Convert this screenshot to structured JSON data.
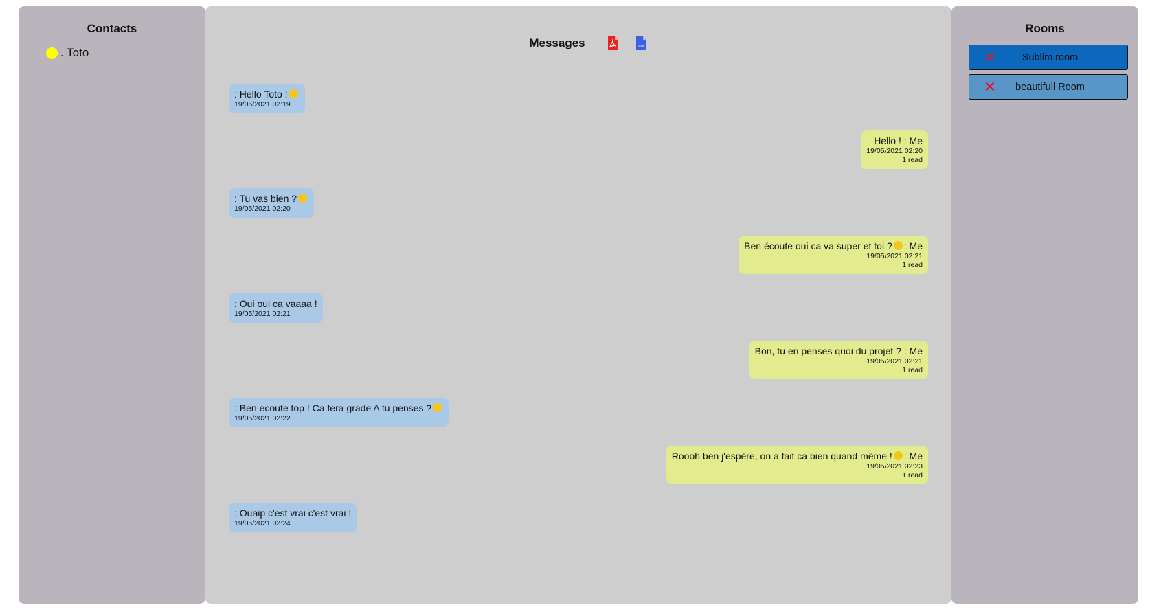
{
  "contacts": {
    "title": "Contacts",
    "items": [
      {
        "label": ". Toto",
        "status_color": "#ffff00"
      }
    ]
  },
  "messages": {
    "title": "Messages",
    "export_pdf_icon": "pdf-file-icon",
    "export_csv_icon": "csv-file-icon",
    "csv_icon_text": "csv",
    "list": [
      {
        "side": "in",
        "text": ": Hello Toto !",
        "emoji": "smiling-face",
        "time": "19/05/2021 02:19",
        "read": ""
      },
      {
        "side": "out",
        "text": "Hello ! : Me",
        "emoji": "",
        "time": "19/05/2021 02:20",
        "read": "1 read"
      },
      {
        "side": "in",
        "text": ": Tu vas bien ?",
        "emoji": "smiling-face-with-hearts",
        "time": "19/05/2021 02:20",
        "read": ""
      },
      {
        "side": "out",
        "text": "Ben écoute oui ca va super et toi ?",
        "emoji": "thinking-face",
        "suffix": ": Me",
        "time": "19/05/2021 02:21",
        "read": "1 read"
      },
      {
        "side": "in",
        "text": ": Oui oui ca vaaaa !",
        "emoji": "",
        "time": "19/05/2021 02:21",
        "read": ""
      },
      {
        "side": "out",
        "text": "Bon, tu en penses quoi du projet ? : Me",
        "emoji": "",
        "time": "19/05/2021 02:21",
        "read": "1 read"
      },
      {
        "side": "in",
        "text": ": Ben écoute top ! Ca fera grade A tu penses ?",
        "emoji": "zipper-mouth-face",
        "time": "19/05/2021 02:22",
        "read": ""
      },
      {
        "side": "out",
        "text": "Roooh ben j'espère, on a fait ca bien quand même !",
        "emoji": "smiling-face-with-halo",
        "suffix": ": Me",
        "time": "19/05/2021 02:23",
        "read": "1 read"
      },
      {
        "side": "in",
        "text": ": Ouaip c'est vrai c'est vrai !",
        "emoji": "",
        "time": "19/05/2021 02:24",
        "read": ""
      }
    ]
  },
  "rooms": {
    "title": "Rooms",
    "items": [
      {
        "label": "Sublim room",
        "icon": "close-icon",
        "color": "#0b68bd"
      },
      {
        "label": "beautifull Room",
        "icon": "close-icon",
        "color": "#5996c8"
      }
    ]
  }
}
